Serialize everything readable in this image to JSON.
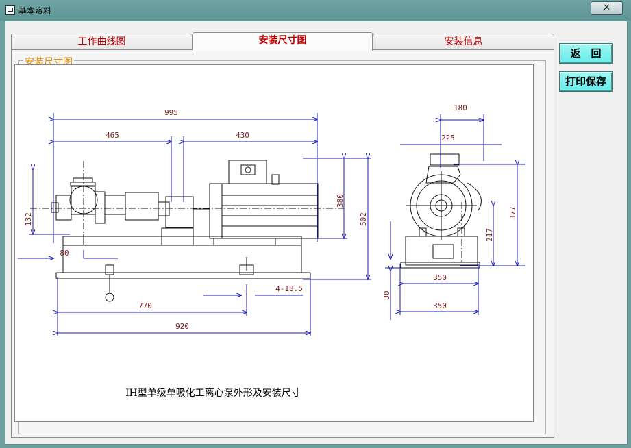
{
  "window": {
    "title": "基本资料",
    "close_label": "✕"
  },
  "tabs": [
    {
      "label": "工作曲线图"
    },
    {
      "label": "安装尺寸图"
    },
    {
      "label": "安装信息"
    }
  ],
  "groupbox": {
    "label": "安装尺寸图"
  },
  "drawing": {
    "caption": "IH型单级单吸化工离心泵外形及安装尺寸",
    "dimensions": {
      "d995": "995",
      "d465": "465",
      "d430": "430",
      "d380": "380",
      "d502": "502",
      "d132": "132",
      "d80": "80",
      "d770": "770",
      "d920": "920",
      "d4185": "4-18.5",
      "d180": "180",
      "d225": "225",
      "d377": "377",
      "d217": "217",
      "d350a": "350",
      "d350b": "350",
      "d30": "30"
    }
  },
  "buttons": {
    "back_label": "返　回",
    "print_label": "打印保存"
  }
}
